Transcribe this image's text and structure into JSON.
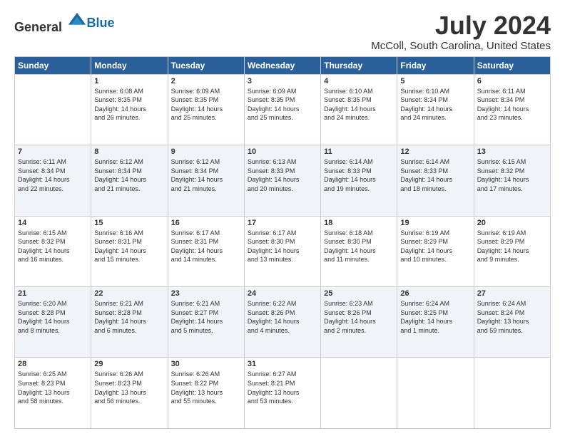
{
  "header": {
    "logo_general": "General",
    "logo_blue": "Blue",
    "month_year": "July 2024",
    "location": "McColl, South Carolina, United States"
  },
  "weekdays": [
    "Sunday",
    "Monday",
    "Tuesday",
    "Wednesday",
    "Thursday",
    "Friday",
    "Saturday"
  ],
  "weeks": [
    [
      {
        "day": "",
        "info": ""
      },
      {
        "day": "1",
        "info": "Sunrise: 6:08 AM\nSunset: 8:35 PM\nDaylight: 14 hours\nand 26 minutes."
      },
      {
        "day": "2",
        "info": "Sunrise: 6:09 AM\nSunset: 8:35 PM\nDaylight: 14 hours\nand 25 minutes."
      },
      {
        "day": "3",
        "info": "Sunrise: 6:09 AM\nSunset: 8:35 PM\nDaylight: 14 hours\nand 25 minutes."
      },
      {
        "day": "4",
        "info": "Sunrise: 6:10 AM\nSunset: 8:35 PM\nDaylight: 14 hours\nand 24 minutes."
      },
      {
        "day": "5",
        "info": "Sunrise: 6:10 AM\nSunset: 8:34 PM\nDaylight: 14 hours\nand 24 minutes."
      },
      {
        "day": "6",
        "info": "Sunrise: 6:11 AM\nSunset: 8:34 PM\nDaylight: 14 hours\nand 23 minutes."
      }
    ],
    [
      {
        "day": "7",
        "info": "Sunrise: 6:11 AM\nSunset: 8:34 PM\nDaylight: 14 hours\nand 22 minutes."
      },
      {
        "day": "8",
        "info": "Sunrise: 6:12 AM\nSunset: 8:34 PM\nDaylight: 14 hours\nand 21 minutes."
      },
      {
        "day": "9",
        "info": "Sunrise: 6:12 AM\nSunset: 8:34 PM\nDaylight: 14 hours\nand 21 minutes."
      },
      {
        "day": "10",
        "info": "Sunrise: 6:13 AM\nSunset: 8:33 PM\nDaylight: 14 hours\nand 20 minutes."
      },
      {
        "day": "11",
        "info": "Sunrise: 6:14 AM\nSunset: 8:33 PM\nDaylight: 14 hours\nand 19 minutes."
      },
      {
        "day": "12",
        "info": "Sunrise: 6:14 AM\nSunset: 8:33 PM\nDaylight: 14 hours\nand 18 minutes."
      },
      {
        "day": "13",
        "info": "Sunrise: 6:15 AM\nSunset: 8:32 PM\nDaylight: 14 hours\nand 17 minutes."
      }
    ],
    [
      {
        "day": "14",
        "info": "Sunrise: 6:15 AM\nSunset: 8:32 PM\nDaylight: 14 hours\nand 16 minutes."
      },
      {
        "day": "15",
        "info": "Sunrise: 6:16 AM\nSunset: 8:31 PM\nDaylight: 14 hours\nand 15 minutes."
      },
      {
        "day": "16",
        "info": "Sunrise: 6:17 AM\nSunset: 8:31 PM\nDaylight: 14 hours\nand 14 minutes."
      },
      {
        "day": "17",
        "info": "Sunrise: 6:17 AM\nSunset: 8:30 PM\nDaylight: 14 hours\nand 13 minutes."
      },
      {
        "day": "18",
        "info": "Sunrise: 6:18 AM\nSunset: 8:30 PM\nDaylight: 14 hours\nand 11 minutes."
      },
      {
        "day": "19",
        "info": "Sunrise: 6:19 AM\nSunset: 8:29 PM\nDaylight: 14 hours\nand 10 minutes."
      },
      {
        "day": "20",
        "info": "Sunrise: 6:19 AM\nSunset: 8:29 PM\nDaylight: 14 hours\nand 9 minutes."
      }
    ],
    [
      {
        "day": "21",
        "info": "Sunrise: 6:20 AM\nSunset: 8:28 PM\nDaylight: 14 hours\nand 8 minutes."
      },
      {
        "day": "22",
        "info": "Sunrise: 6:21 AM\nSunset: 8:28 PM\nDaylight: 14 hours\nand 6 minutes."
      },
      {
        "day": "23",
        "info": "Sunrise: 6:21 AM\nSunset: 8:27 PM\nDaylight: 14 hours\nand 5 minutes."
      },
      {
        "day": "24",
        "info": "Sunrise: 6:22 AM\nSunset: 8:26 PM\nDaylight: 14 hours\nand 4 minutes."
      },
      {
        "day": "25",
        "info": "Sunrise: 6:23 AM\nSunset: 8:26 PM\nDaylight: 14 hours\nand 2 minutes."
      },
      {
        "day": "26",
        "info": "Sunrise: 6:24 AM\nSunset: 8:25 PM\nDaylight: 14 hours\nand 1 minute."
      },
      {
        "day": "27",
        "info": "Sunrise: 6:24 AM\nSunset: 8:24 PM\nDaylight: 13 hours\nand 59 minutes."
      }
    ],
    [
      {
        "day": "28",
        "info": "Sunrise: 6:25 AM\nSunset: 8:23 PM\nDaylight: 13 hours\nand 58 minutes."
      },
      {
        "day": "29",
        "info": "Sunrise: 6:26 AM\nSunset: 8:23 PM\nDaylight: 13 hours\nand 56 minutes."
      },
      {
        "day": "30",
        "info": "Sunrise: 6:26 AM\nSunset: 8:22 PM\nDaylight: 13 hours\nand 55 minutes."
      },
      {
        "day": "31",
        "info": "Sunrise: 6:27 AM\nSunset: 8:21 PM\nDaylight: 13 hours\nand 53 minutes."
      },
      {
        "day": "",
        "info": ""
      },
      {
        "day": "",
        "info": ""
      },
      {
        "day": "",
        "info": ""
      }
    ]
  ]
}
